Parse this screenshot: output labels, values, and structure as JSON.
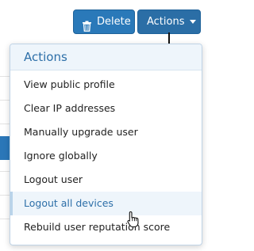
{
  "toolbar": {
    "delete_label": "Delete",
    "actions_label": "Actions",
    "button_color": "#2a79b9"
  },
  "icons": {
    "delete": "trash-icon",
    "actions": "caret-down-icon"
  },
  "dropdown": {
    "title": "Actions",
    "items": [
      {
        "label": "View public profile"
      },
      {
        "label": "Clear IP addresses"
      },
      {
        "label": "Manually upgrade user"
      },
      {
        "label": "Ignore globally"
      },
      {
        "label": "Logout user"
      },
      {
        "label": "Logout all devices"
      },
      {
        "label": "Rebuild user reputation score"
      }
    ]
  }
}
